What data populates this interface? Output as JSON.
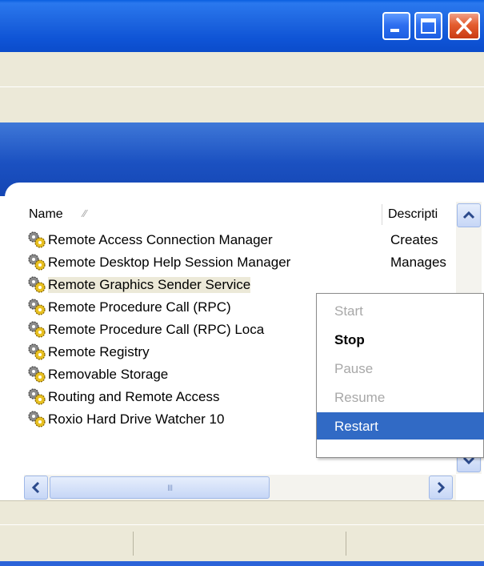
{
  "window": {
    "controls": {
      "minimize_icon": "minimize-icon",
      "maximize_icon": "maximize-icon",
      "close_icon": "close-icon"
    }
  },
  "list": {
    "columns": {
      "name": "Name",
      "description": "Descripti"
    },
    "sorted_column": "Name",
    "rows": [
      {
        "name": "Remote Access Connection Manager",
        "description": "Creates"
      },
      {
        "name": "Remote Desktop Help Session Manager",
        "description": "Manages"
      },
      {
        "name": "Remote Graphics Sender Service",
        "description": ""
      },
      {
        "name": "Remote Procedure Call (RPC)",
        "description": ""
      },
      {
        "name": "Remote Procedure Call (RPC) Loca",
        "description": ""
      },
      {
        "name": "Remote Registry",
        "description": ""
      },
      {
        "name": "Removable Storage",
        "description": ""
      },
      {
        "name": "Routing and Remote Access",
        "description": ""
      },
      {
        "name": "Roxio Hard Drive Watcher 10",
        "description": ""
      }
    ],
    "selected_row": "Remote Graphics Sender Service"
  },
  "context_menu": {
    "items": [
      {
        "label": "Start",
        "state": "disabled"
      },
      {
        "label": "Stop",
        "state": "default"
      },
      {
        "label": "Pause",
        "state": "disabled"
      },
      {
        "label": "Resume",
        "state": "disabled"
      },
      {
        "label": "Restart",
        "state": "highlighted"
      }
    ]
  },
  "scrollbars": {
    "horizontal_grip": "III",
    "icons": [
      "scroll-up-arrow-icon",
      "scroll-down-arrow-icon",
      "scroll-left-arrow-icon",
      "scroll-right-arrow-icon"
    ]
  },
  "colors": {
    "titlebar": "#0f54d6",
    "selection_highlight": "#316ac5",
    "chrome": "#ece9d8"
  }
}
